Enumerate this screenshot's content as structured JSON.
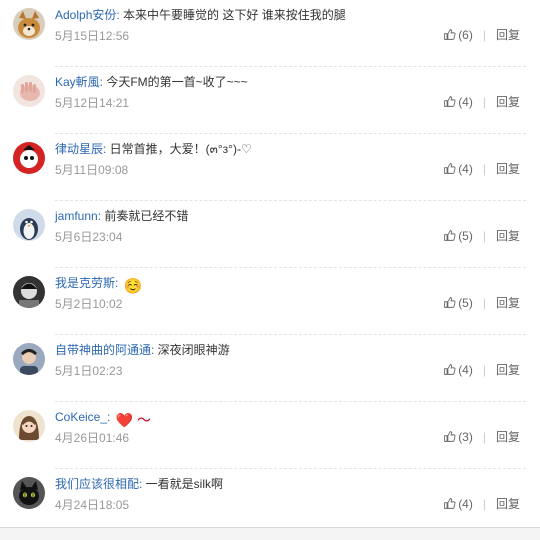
{
  "comments": [
    {
      "user": "Adolph安份:",
      "text": " 本来中午要睡觉的 这下好 谁来按住我的腿",
      "time": "5月15日12:56",
      "like_count": "(6)",
      "reply_label": "回复",
      "avatar_icon": "shiba-dog-avatar",
      "avatar_color": "#c98a3c"
    },
    {
      "user": "Kay斬風:",
      "text": " 今天FM的第一首~收了~~~",
      "time": "5月12日14:21",
      "like_count": "(4)",
      "reply_label": "回复",
      "avatar_icon": "hand-avatar",
      "avatar_color": "#e8b8b0"
    },
    {
      "user": "律动星辰:",
      "text": " 日常首推，大爱！(๓°з°)-♡",
      "time": "5月11日09:08",
      "like_count": "(4)",
      "reply_label": "回复",
      "avatar_icon": "red-mascot-avatar",
      "avatar_color": "#d42323"
    },
    {
      "user": "jamfunn:",
      "text": " 前奏就已经不错",
      "time": "5月6日23:04",
      "like_count": "(5)",
      "reply_label": "回复",
      "avatar_icon": "penguin-avatar",
      "avatar_color": "#5b7aa8"
    },
    {
      "user": "我是克劳斯:",
      "text": " ",
      "emoji": "☺️",
      "time": "5月2日10:02",
      "like_count": "(5)",
      "reply_label": "回复",
      "avatar_icon": "bw-face-avatar",
      "avatar_color": "#444444"
    },
    {
      "user": "自带神曲的阿通通:",
      "text": " 深夜闭眼神游",
      "time": "5月1日02:23",
      "like_count": "(4)",
      "reply_label": "回复",
      "avatar_icon": "person-avatar",
      "avatar_color": "#6b7c93"
    },
    {
      "user": "CoKeice_:",
      "text": " ",
      "emoji": "❤️ ～",
      "time": "4月26日01:46",
      "like_count": "(3)",
      "reply_label": "回复",
      "avatar_icon": "girl-avatar",
      "avatar_color": "#c9a27a"
    },
    {
      "user": "我们应该很相配:",
      "text": " 一看就是silk啊",
      "time": "4月24日18:05",
      "like_count": "(4)",
      "reply_label": "回复",
      "avatar_icon": "black-cat-avatar",
      "avatar_color": "#2a2a2a"
    }
  ],
  "colors": {
    "username": "#2d68b2",
    "time": "#999999",
    "text": "#333333"
  }
}
